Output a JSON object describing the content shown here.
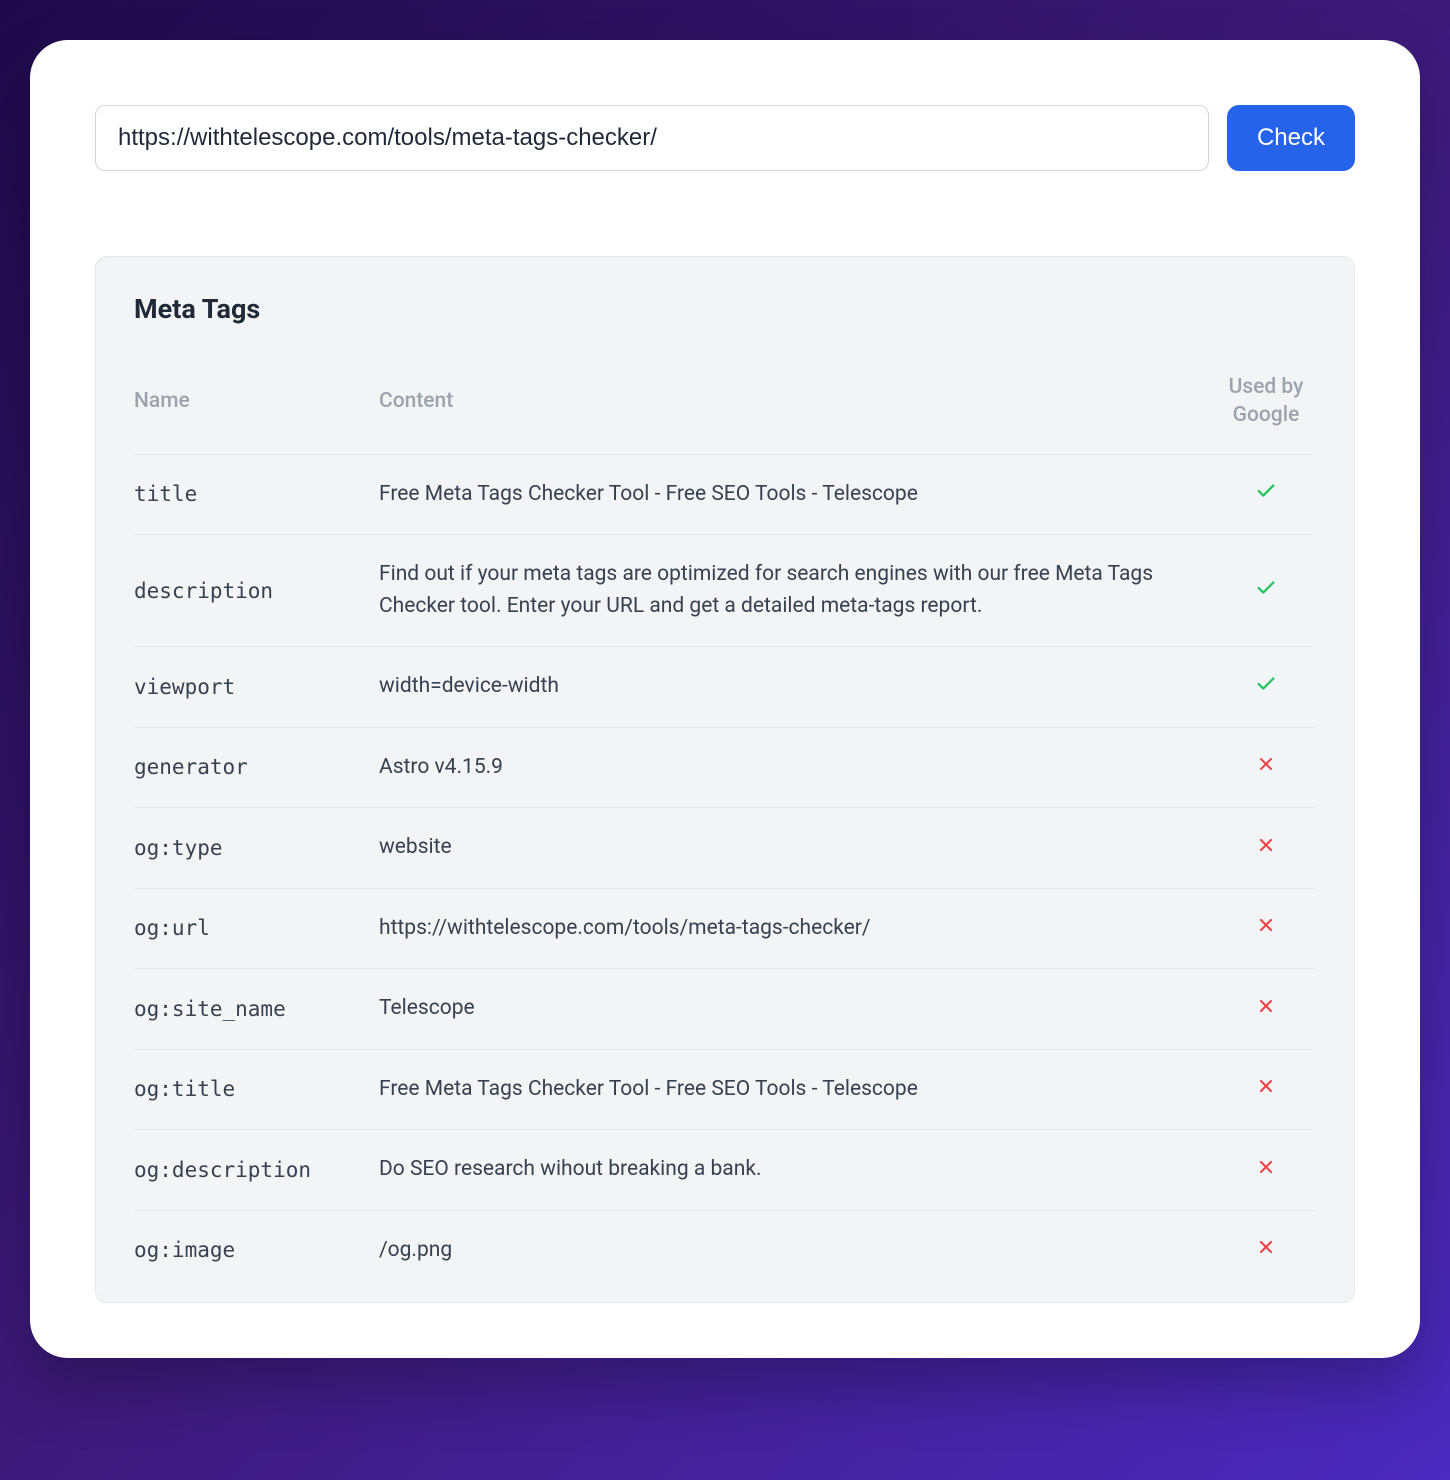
{
  "url_bar": {
    "value": "https://withtelescope.com/tools/meta-tags-checker/",
    "button_label": "Check"
  },
  "results": {
    "title": "Meta Tags",
    "columns": {
      "name": "Name",
      "content": "Content",
      "used_by_google": "Used by Google"
    },
    "rows": [
      {
        "name": "title",
        "content": "Free Meta Tags Checker Tool - Free SEO Tools - Telescope",
        "used_by_google": true
      },
      {
        "name": "description",
        "content": "Find out if your meta tags are optimized for search engines with our free Meta Tags Checker tool. Enter your URL and get a detailed meta-tags report.",
        "used_by_google": true
      },
      {
        "name": "viewport",
        "content": "width=device-width",
        "used_by_google": true
      },
      {
        "name": "generator",
        "content": "Astro v4.15.9",
        "used_by_google": false
      },
      {
        "name": "og:type",
        "content": "website",
        "used_by_google": false
      },
      {
        "name": "og:url",
        "content": "https://withtelescope.com/tools/meta-tags-checker/",
        "used_by_google": false
      },
      {
        "name": "og:site_name",
        "content": "Telescope",
        "used_by_google": false
      },
      {
        "name": "og:title",
        "content": "Free Meta Tags Checker Tool - Free SEO Tools - Telescope",
        "used_by_google": false
      },
      {
        "name": "og:description",
        "content": "Do SEO research wihout breaking a bank.",
        "used_by_google": false
      },
      {
        "name": "og:image",
        "content": "/og.png",
        "used_by_google": false
      }
    ]
  }
}
